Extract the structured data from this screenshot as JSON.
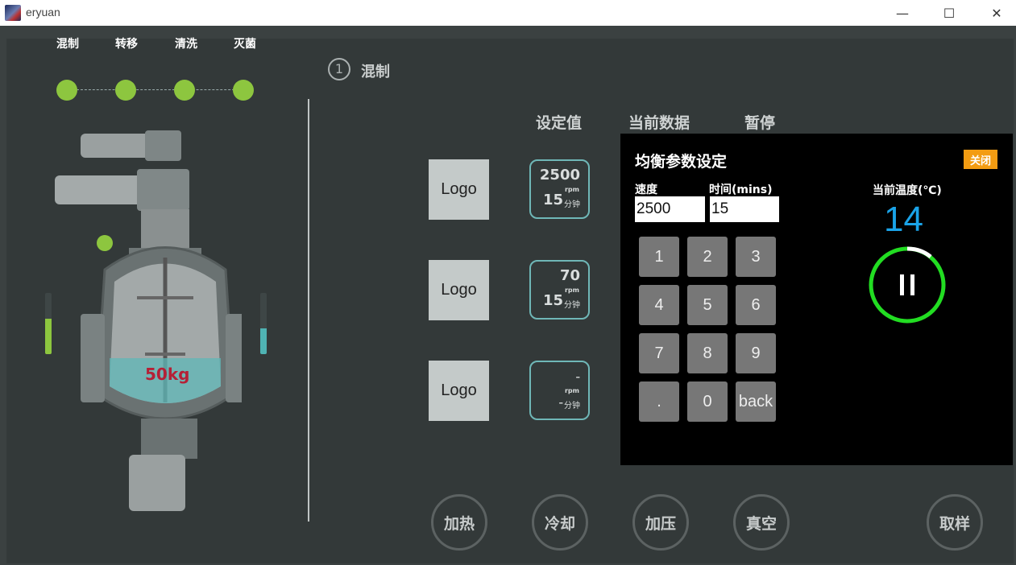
{
  "window": {
    "title": "eryuan",
    "min": "—",
    "max": "☐",
    "close": "✕"
  },
  "steps": [
    "混制",
    "转移",
    "清洗",
    "灭菌"
  ],
  "current_step": {
    "number": "1",
    "title": "混制"
  },
  "columns": {
    "set_value": "设定值",
    "current_data": "当前数据",
    "pause": "暂停"
  },
  "rows": [
    {
      "logo": "Logo",
      "rpm": "2500",
      "rpm_unit": "rpm",
      "mins": "15",
      "mins_unit": "分钟"
    },
    {
      "logo": "Logo",
      "rpm": "70",
      "rpm_unit": "rpm",
      "mins": "15",
      "mins_unit": "分钟"
    },
    {
      "logo": "Logo",
      "rpm": "–",
      "rpm_unit": "rpm",
      "mins": "–",
      "mins_unit": "分钟"
    }
  ],
  "machine": {
    "weight": "50kg",
    "left_gauge_level": 0.58,
    "right_gauge_level": 0.42,
    "colors": {
      "left_gauge": "#8dc63f",
      "right_gauge": "#4fb3b3"
    }
  },
  "buttons": {
    "heat": "加热",
    "cool": "冷却",
    "pressure": "加压",
    "vacuum": "真空",
    "sample": "取样"
  },
  "dialog": {
    "title": "均衡参数设定",
    "close": "关闭",
    "speed_label": "速度",
    "speed_value": "2500",
    "time_label": "时间(mins)",
    "time_value": "15",
    "keys": [
      "1",
      "2",
      "3",
      "4",
      "5",
      "6",
      "7",
      "8",
      "9",
      ".",
      "0",
      "back"
    ],
    "temp_label": "当前温度(℃)",
    "temp_value": "14",
    "pause_icon": "pause-icon",
    "colors": {
      "accent": "#f39c12",
      "temp": "#1aa3e8",
      "ring": "#22dd22"
    }
  }
}
